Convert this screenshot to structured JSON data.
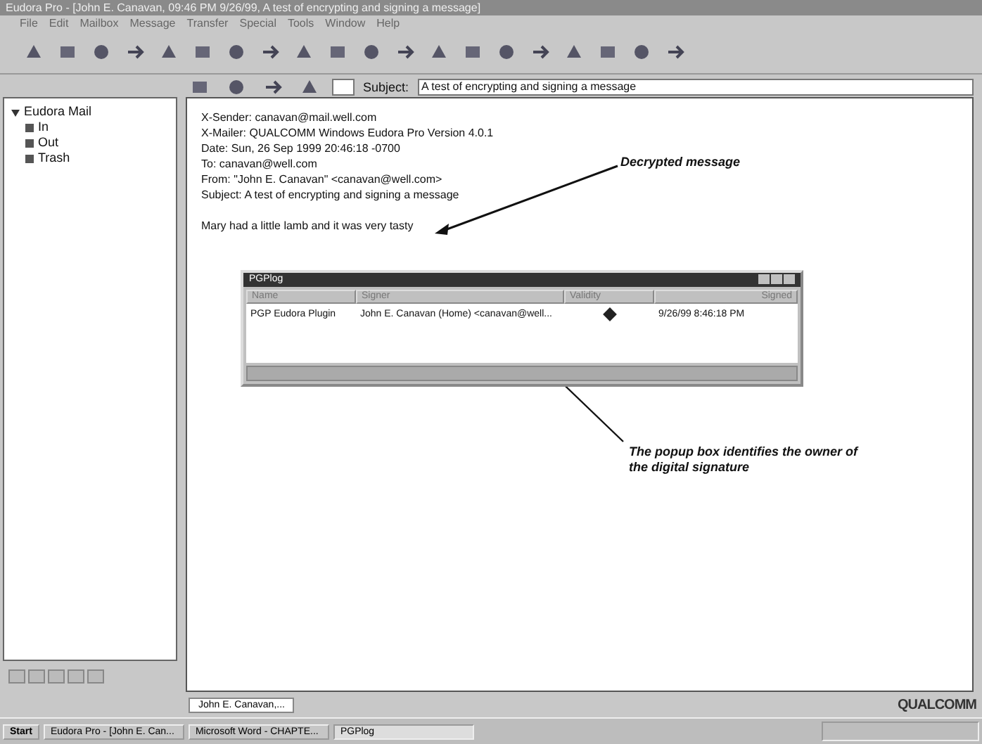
{
  "window": {
    "title": "Eudora Pro - [John E. Canavan, 09:46 PM 9/26/99, A test of encrypting and signing a message]"
  },
  "menu": [
    "File",
    "Edit",
    "Mailbox",
    "Message",
    "Transfer",
    "Special",
    "Tools",
    "Window",
    "Help"
  ],
  "mailboxes": {
    "label": "Eudora Mail",
    "expanded": true,
    "children": [
      {
        "label": "In"
      },
      {
        "label": "Out"
      },
      {
        "label": "Trash"
      }
    ]
  },
  "message_toolbar": {
    "subject_label": "Subject:",
    "subject": "A test of encrypting and signing a message"
  },
  "headers": [
    "X-Sender: canavan@mail.well.com",
    "X-Mailer: QUALCOMM Windows Eudora Pro Version 4.0.1",
    "Date: Sun, 26 Sep 1999 20:46:18 -0700",
    "To: canavan@well.com",
    "From: \"John E. Canavan\" <canavan@well.com>",
    "Subject: A test of encrypting and signing a message"
  ],
  "body": "Mary had a little lamb and it was very tasty",
  "annotations": [
    "Decrypted message",
    "The popup box identifies the owner of the digital signature"
  ],
  "popup": {
    "title": "PGPlog",
    "columns": [
      "Name",
      "Signer",
      "Validity",
      "Signed"
    ],
    "rows": [
      {
        "name": "PGP Eudora Plugin",
        "signer": "John E. Canavan (Home) <canavan@well...",
        "signed": "9/26/99 8:46:18 PM"
      }
    ]
  },
  "window_tabs": [
    {
      "label": "John E. Canavan,...",
      "selected": true
    }
  ],
  "logo": "QUALCOMM",
  "taskbar": {
    "start": "Start",
    "tasks": [
      {
        "label": "Eudora Pro - [John E. Can...",
        "selected": false
      },
      {
        "label": "Microsoft Word - CHAPTE...",
        "selected": false
      },
      {
        "label": "PGPlog",
        "selected": true
      }
    ]
  }
}
